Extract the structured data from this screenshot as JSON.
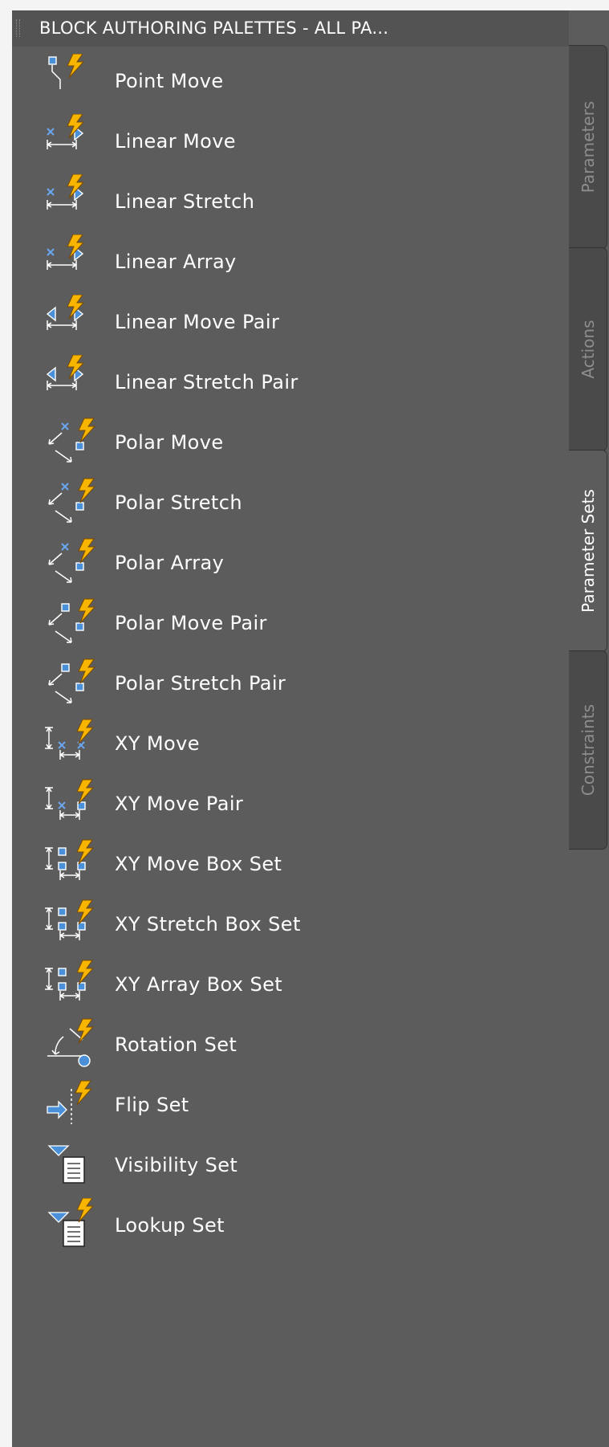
{
  "palette": {
    "title": "BLOCK AUTHORING PALETTES - ALL PA...",
    "tabs": [
      {
        "label": "Parameters",
        "active": false
      },
      {
        "label": "Actions",
        "active": false
      },
      {
        "label": "Parameter Sets",
        "active": true
      },
      {
        "label": "Constraints",
        "active": false
      }
    ],
    "items": [
      {
        "label": "Point Move",
        "icon": "point-move-icon"
      },
      {
        "label": "Linear Move",
        "icon": "linear-move-icon"
      },
      {
        "label": "Linear Stretch",
        "icon": "linear-stretch-icon"
      },
      {
        "label": "Linear Array",
        "icon": "linear-array-icon"
      },
      {
        "label": "Linear Move Pair",
        "icon": "linear-move-pair-icon"
      },
      {
        "label": "Linear Stretch Pair",
        "icon": "linear-stretch-pair-icon"
      },
      {
        "label": "Polar Move",
        "icon": "polar-move-icon"
      },
      {
        "label": "Polar Stretch",
        "icon": "polar-stretch-icon"
      },
      {
        "label": "Polar Array",
        "icon": "polar-array-icon"
      },
      {
        "label": "Polar Move Pair",
        "icon": "polar-move-pair-icon"
      },
      {
        "label": "Polar Stretch Pair",
        "icon": "polar-stretch-pair-icon"
      },
      {
        "label": "XY Move",
        "icon": "xy-move-icon"
      },
      {
        "label": "XY Move Pair",
        "icon": "xy-move-pair-icon"
      },
      {
        "label": "XY Move Box Set",
        "icon": "xy-move-box-set-icon"
      },
      {
        "label": "XY Stretch Box Set",
        "icon": "xy-stretch-box-set-icon"
      },
      {
        "label": "XY Array Box Set",
        "icon": "xy-array-box-set-icon"
      },
      {
        "label": "Rotation Set",
        "icon": "rotation-set-icon"
      },
      {
        "label": "Flip Set",
        "icon": "flip-set-icon"
      },
      {
        "label": "Visibility Set",
        "icon": "visibility-set-icon"
      },
      {
        "label": "Lookup Set",
        "icon": "lookup-set-icon"
      }
    ]
  },
  "colors": {
    "panel": "#5c5c5c",
    "lightning": "#f7b500",
    "grip_blue": "#4a90d9",
    "text": "#ffffff"
  }
}
